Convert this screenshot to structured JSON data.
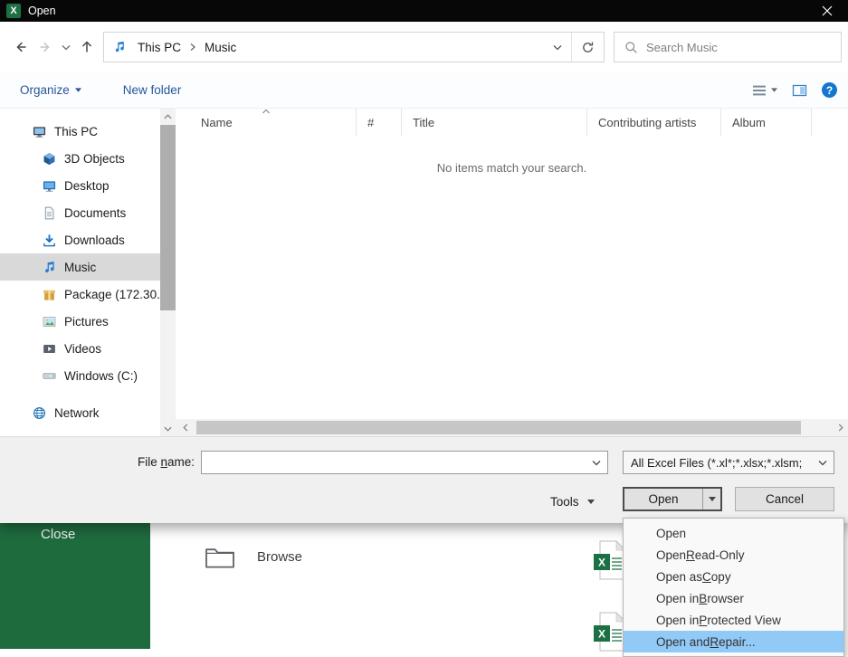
{
  "colors": {
    "titlebar": "#070707",
    "excel_green": "#1d7044",
    "backstage_green": "#1e6b3e",
    "accent_blue": "#0078d7",
    "menu_highlight": "#91c9f7",
    "tree_selection": "#d9d9d9",
    "command_blue": "#26569a"
  },
  "icons": {
    "excel_badge_glyph": "X",
    "help_glyph": "?"
  },
  "window": {
    "title": "Open"
  },
  "nav": {
    "breadcrumb": [
      "This PC",
      "Music"
    ],
    "search_placeholder": "Search Music"
  },
  "toolbar": {
    "organize_label": "Organize",
    "new_folder_label": "New folder"
  },
  "sidebar": {
    "items": [
      {
        "label": "This PC",
        "icon": "computer-icon",
        "depth": 0,
        "selected": false,
        "group_gap": false
      },
      {
        "label": "3D Objects",
        "icon": "cube-icon",
        "depth": 1,
        "selected": false,
        "group_gap": false
      },
      {
        "label": "Desktop",
        "icon": "desktop-icon",
        "depth": 1,
        "selected": false,
        "group_gap": false
      },
      {
        "label": "Documents",
        "icon": "document-icon",
        "depth": 1,
        "selected": false,
        "group_gap": false
      },
      {
        "label": "Downloads",
        "icon": "download-icon",
        "depth": 1,
        "selected": false,
        "group_gap": false
      },
      {
        "label": "Music",
        "icon": "music-icon",
        "depth": 1,
        "selected": true,
        "group_gap": false
      },
      {
        "label": "Package (172.30.",
        "icon": "package-icon",
        "depth": 1,
        "selected": false,
        "group_gap": false
      },
      {
        "label": "Pictures",
        "icon": "pictures-icon",
        "depth": 1,
        "selected": false,
        "group_gap": false
      },
      {
        "label": "Videos",
        "icon": "videos-icon",
        "depth": 1,
        "selected": false,
        "group_gap": false
      },
      {
        "label": "Windows (C:)",
        "icon": "drive-icon",
        "depth": 1,
        "selected": false,
        "group_gap": false
      },
      {
        "label": "Network",
        "icon": "network-icon",
        "depth": 0,
        "selected": false,
        "group_gap": true
      }
    ]
  },
  "file_list": {
    "columns": [
      {
        "label": "Name",
        "sorted": "asc"
      },
      {
        "label": "#",
        "sorted": ""
      },
      {
        "label": "Title",
        "sorted": ""
      },
      {
        "label": "Contributing artists",
        "sorted": ""
      },
      {
        "label": "Album",
        "sorted": ""
      }
    ],
    "empty_text": "No items match your search."
  },
  "footer": {
    "file_name_label": "File name:",
    "file_name_accel_index": 5,
    "file_name_value": "",
    "file_type_value": "All Excel Files (*.xl*;*.xlsx;*.xlsm;",
    "tools_label": "Tools",
    "open_label": "Open",
    "cancel_label": "Cancel"
  },
  "open_menu": {
    "items": [
      {
        "label": "Open",
        "accel_index": -1,
        "selected": false
      },
      {
        "label": "Open Read-Only",
        "accel_index": 5,
        "selected": false
      },
      {
        "label": "Open as Copy",
        "accel_index": 8,
        "selected": false
      },
      {
        "label": "Open in Browser",
        "accel_index": 8,
        "selected": false
      },
      {
        "label": "Open in Protected View",
        "accel_index": 8,
        "selected": false
      },
      {
        "label": "Open and Repair...",
        "accel_index": 9,
        "selected": true
      }
    ]
  },
  "backstage": {
    "close_label": "Close",
    "browse_label": "Browse"
  }
}
